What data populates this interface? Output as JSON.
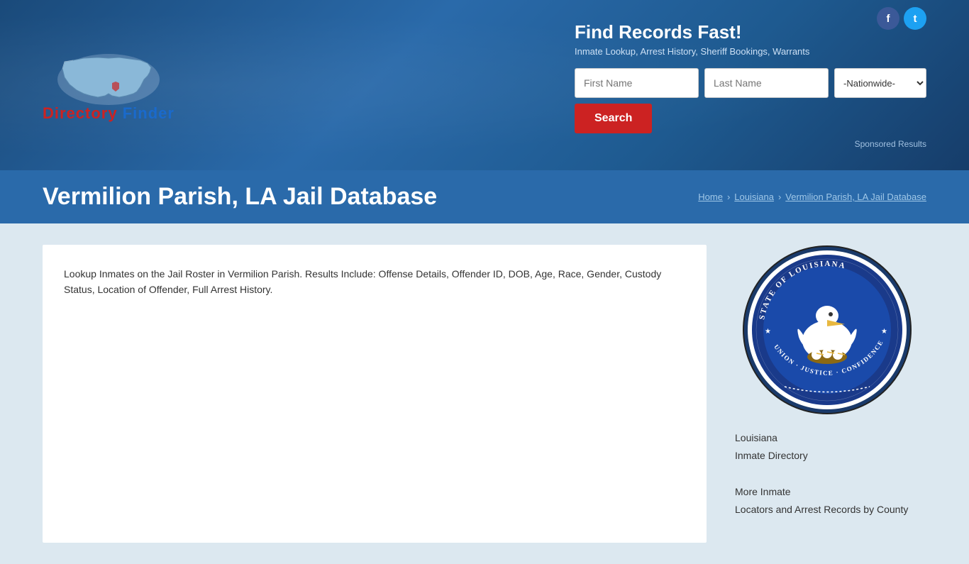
{
  "social": {
    "facebook_label": "f",
    "twitter_label": "t"
  },
  "header": {
    "logo_text_directory": "Directory",
    "logo_text_finder": "Finder",
    "search_title": "Find Records Fast!",
    "search_subtitle": "Inmate Lookup, Arrest History, Sheriff Bookings, Warrants",
    "first_name_placeholder": "First Name",
    "last_name_placeholder": "Last Name",
    "nationwide_option": "-Nationwide-",
    "search_button_label": "Search",
    "sponsored_text": "Sponsored Results"
  },
  "title_bar": {
    "page_title": "Vermilion Parish, LA Jail Database",
    "breadcrumb": {
      "home": "Home",
      "louisiana": "Louisiana",
      "current": "Vermilion Parish, LA Jail Database"
    }
  },
  "main": {
    "description": "Lookup Inmates on the Jail Roster in Vermilion Parish. Results Include: Offense Details, Offender ID, DOB, Age, Race, Gender, Custody Status, Location of Offender, Full Arrest History."
  },
  "sidebar": {
    "line1": "Louisiana",
    "line2": "Inmate Directory",
    "line3": "More Inmate",
    "line4": "Locators and Arrest Records by County"
  }
}
